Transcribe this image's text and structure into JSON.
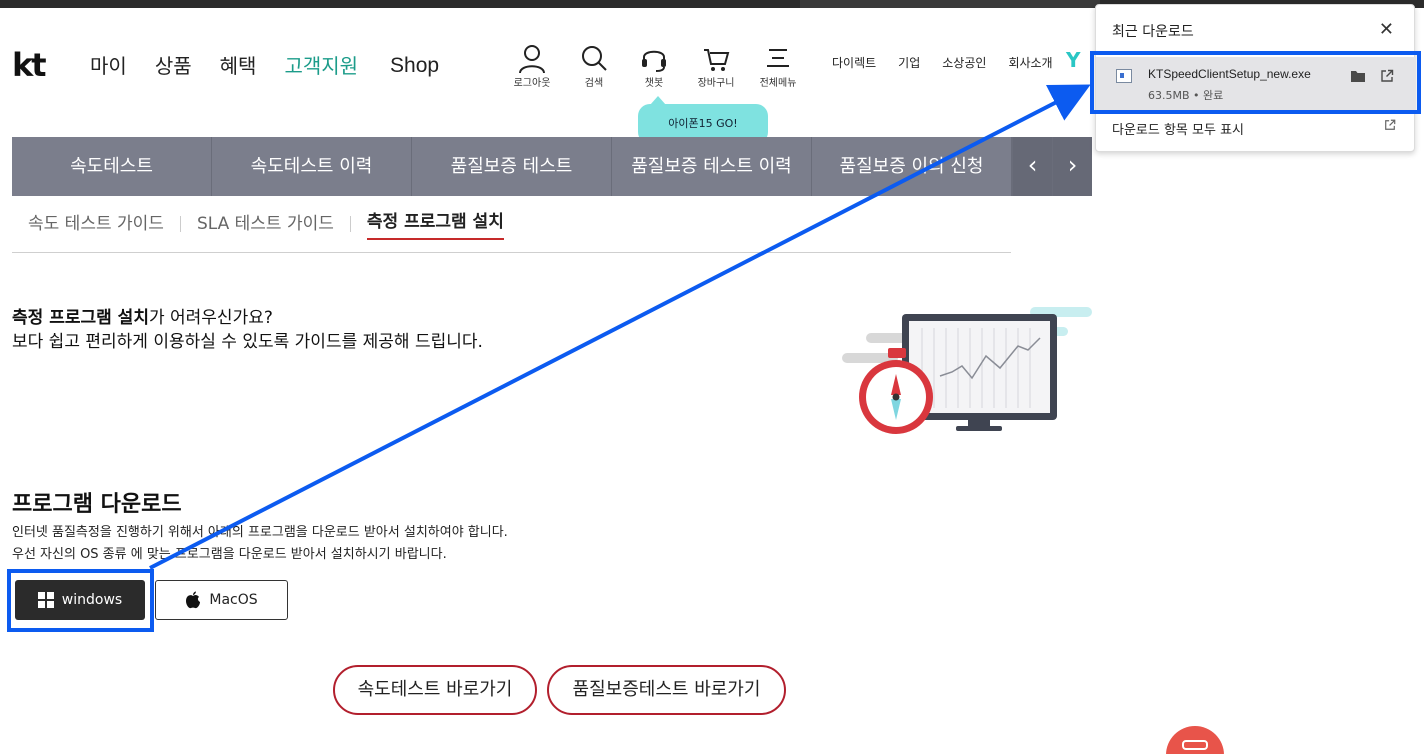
{
  "header": {
    "logo": "kt",
    "nav": [
      "마이",
      "상품",
      "혜택",
      "고객지원",
      "Shop"
    ],
    "nav_active": "고객지원",
    "utils": [
      {
        "icon": "user-icon",
        "label": "로그아웃"
      },
      {
        "icon": "search-icon",
        "label": "검색"
      },
      {
        "icon": "headset-icon",
        "label": "챗봇"
      },
      {
        "icon": "cart-icon",
        "label": "장바구니"
      },
      {
        "icon": "menu-icon",
        "label": "전체메뉴"
      }
    ],
    "top_links": [
      "다이렉트",
      "기업",
      "소상공인",
      "회사소개"
    ],
    "y_mark": "Y",
    "chat_bubble": "아이폰15 GO!"
  },
  "tabbar": {
    "tabs": [
      "속도테스트",
      "속도테스트 이력",
      "품질보증 테스트",
      "품질보증 테스트 이력",
      "품질보증 이의 신청"
    ],
    "prev": "‹",
    "next": "›"
  },
  "subtabs": {
    "items": [
      "속도 테스트 가이드",
      "SLA 테스트 가이드",
      "측정 프로그램 설치"
    ],
    "active": "측정 프로그램 설치"
  },
  "intro": {
    "bold": "측정 프로그램 설치",
    "line1_rest": "가 어려우신가요?",
    "line2": "보다 쉽고 편리하게 이용하실 수 있도록 가이드를 제공해 드립니다."
  },
  "download": {
    "title": "프로그램 다운로드",
    "desc1": "인터넷 품질측정을 진행하기 위해서 아래의 프로그램을 다운로드 받아서 설치하여야 합니다.",
    "desc2": "우선 자신의 OS 종류 에 맞는 프로그램을 다운로드 받아서 설치하시기 바랍니다.",
    "windows_label": "windows",
    "mac_label": "MacOS"
  },
  "shortcuts": {
    "speed": "속도테스트 바로가기",
    "quality": "품질보증테스트 바로가기"
  },
  "download_panel": {
    "title": "최근 다운로드",
    "file_name": "KTSpeedClientSetup_new.exe",
    "file_meta": "63.5MB • 완료",
    "show_all": "다운로드 항목 모두 표시"
  },
  "colors": {
    "accent_teal": "#1c9c8a",
    "tab_bg": "#7b7e8c",
    "brand_red": "#b21f2d",
    "highlight_blue": "#0c5bf0"
  }
}
